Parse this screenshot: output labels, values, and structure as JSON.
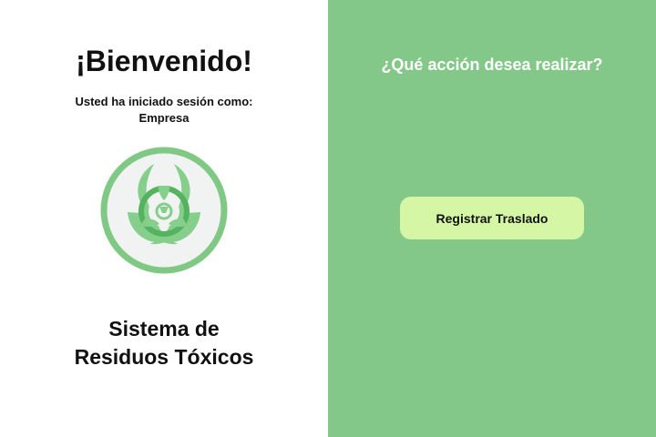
{
  "welcome": {
    "title": "¡Bienvenido!",
    "session_line1": "Usted ha iniciado sesión como:",
    "session_role": "Empresa"
  },
  "system": {
    "title_line1": "Sistema de",
    "title_line2": "Residuos Tóxicos"
  },
  "actions": {
    "question": "¿Qué acción desea realizar?",
    "register_transfer_label": "Registrar Traslado"
  },
  "icons": {
    "logo": "biohazard-icon"
  },
  "colors": {
    "accent_green": "#83c888",
    "button_bg": "#d5f7a5",
    "logo_ring": "#7fc985",
    "logo_fill": "#f1f2f2",
    "logo_symbol": "#86ce8c",
    "logo_symbol_dark": "#54b35e"
  }
}
